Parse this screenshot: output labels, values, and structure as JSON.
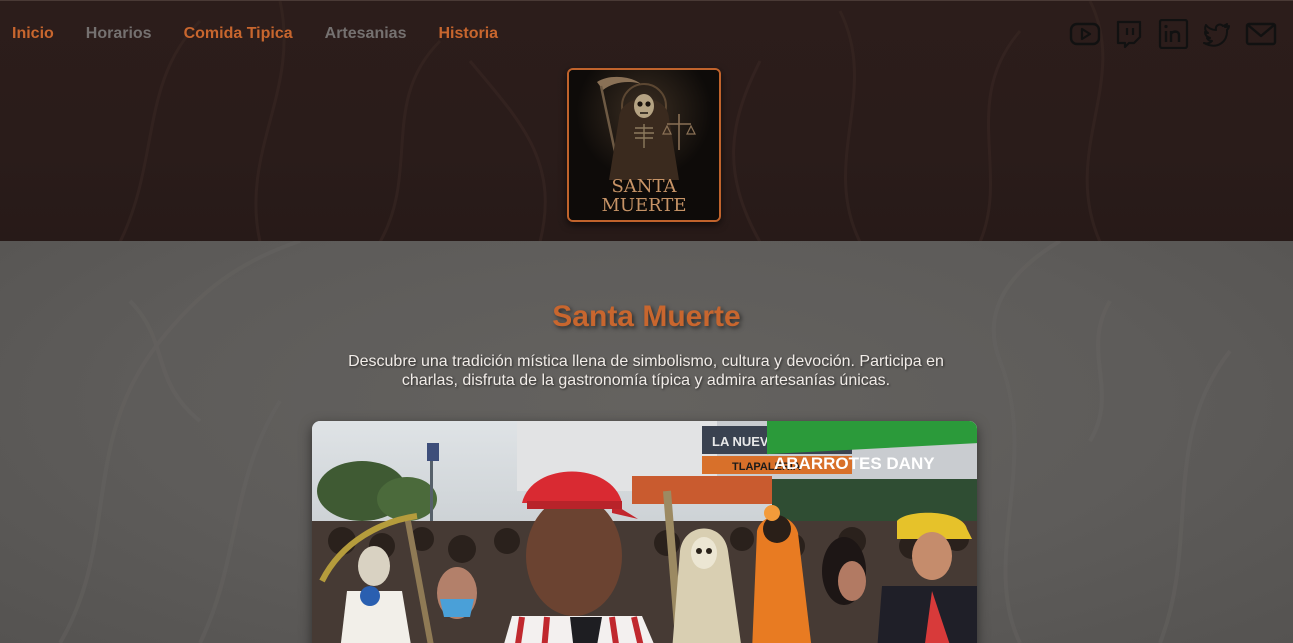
{
  "nav": {
    "items": [
      {
        "label": "Inicio"
      },
      {
        "label": "Horarios"
      },
      {
        "label": "Comida Tipica"
      },
      {
        "label": "Artesanias"
      },
      {
        "label": "Historia"
      }
    ]
  },
  "social": {
    "icons": [
      "youtube-icon",
      "twitch-icon",
      "linkedin-icon",
      "twitter-icon",
      "mail-icon"
    ]
  },
  "logo": {
    "line1": "SANTA",
    "line2": "MUERTE"
  },
  "hero": {
    "title": "Santa Muerte",
    "description": "Descubre una tradición mística llena de simbolismo, cultura y devoción. Participa en charlas, disfruta de la gastronomía típica y admira artesanías únicas."
  },
  "photo": {
    "signs": {
      "left": "LA NUEVA",
      "orange": "TLAPALERIA",
      "green": "ABARROTES DANY"
    }
  },
  "colors": {
    "accent": "#c8662e",
    "header_bg": "#2a1c1a",
    "main_bg": "#5e5c5a",
    "nav_inactive": "#757170"
  }
}
